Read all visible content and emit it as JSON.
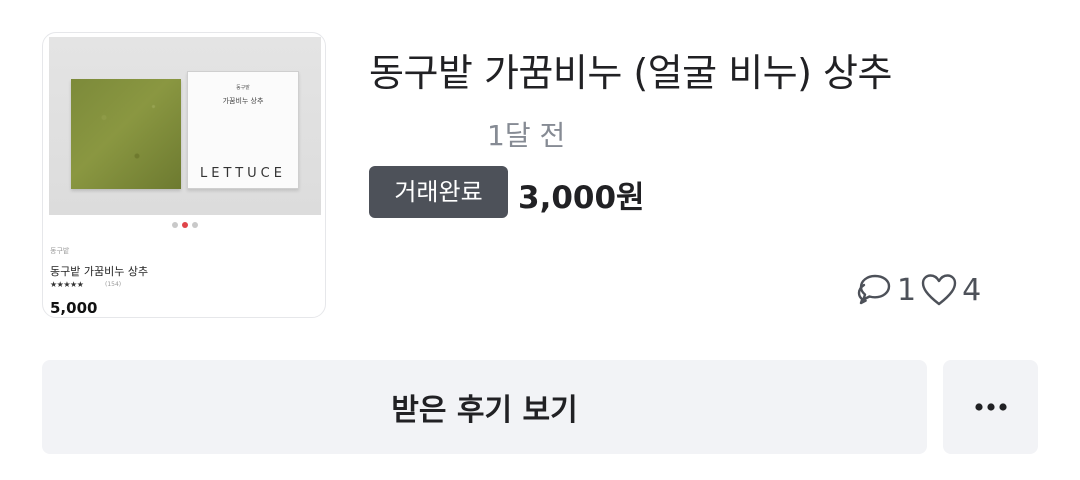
{
  "listing": {
    "title": "동구밭 가꿈비누 (얼굴 비누) 상추",
    "time_ago": "1달 전",
    "status": "거래완료",
    "price": "3,000원",
    "comments_count": "1",
    "likes_count": "4",
    "thumbnail": {
      "box_brand": "동구밭",
      "box_name": "가꿈비누 상추",
      "box_lettuce": "LETTUCE",
      "brand": "동구밭",
      "product_title": "동구밭 가꿈비누 상추",
      "stars": "★★★★★",
      "review_count": "(154)",
      "price": "5,000",
      "carousel_active_index": 2,
      "carousel_total": 3
    }
  },
  "actions": {
    "received_reviews_label": "받은 후기 보기",
    "more_icon": "more-horizontal-icon"
  },
  "icons": {
    "comment": "chat-bubbles-icon",
    "like": "heart-icon"
  },
  "colors": {
    "status_badge_bg": "#4d5159",
    "button_bg": "#f2f3f6",
    "text_primary": "#212124",
    "text_secondary": "#868b94"
  }
}
